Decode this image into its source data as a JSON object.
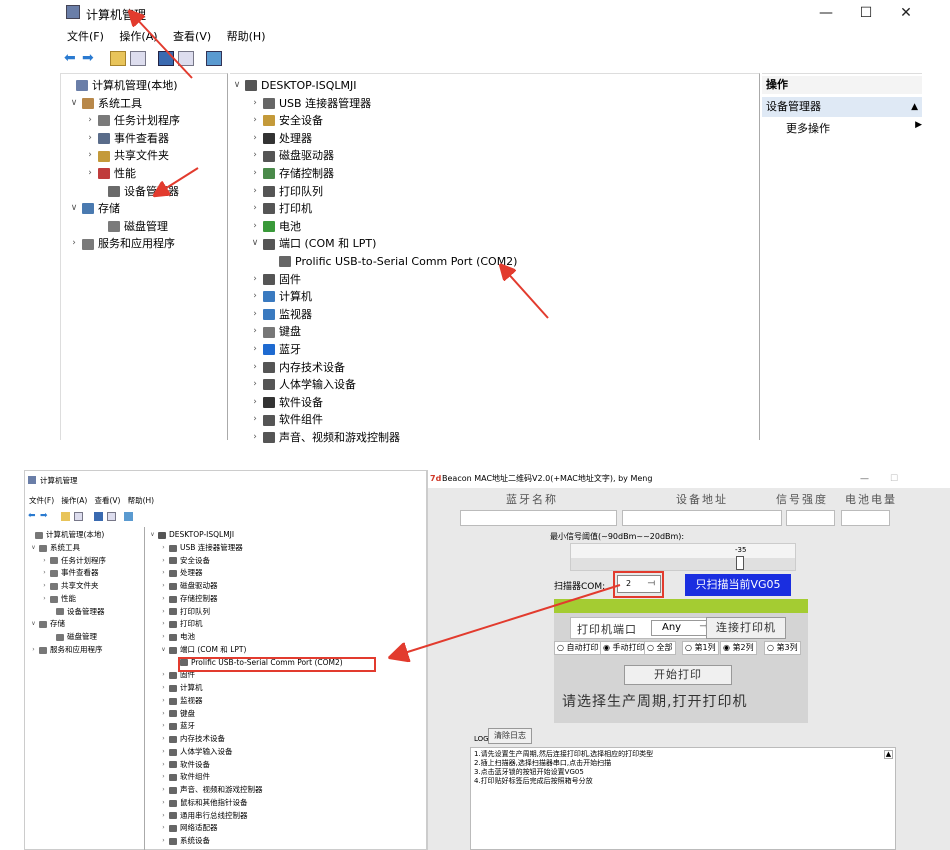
{
  "top_window": {
    "title": "计算机管理",
    "controls": {
      "minimize": "—",
      "maximize": "☐",
      "close": "✕"
    },
    "menu": [
      "文件(F)",
      "操作(A)",
      "查看(V)",
      "帮助(H)"
    ],
    "left_tree": [
      {
        "label": "计算机管理(本地)",
        "chev": "",
        "icon_color": "#6a7ea8"
      },
      {
        "label": "系统工具",
        "chev": "∨",
        "icon_color": "#b8884a"
      },
      {
        "label": "任务计划程序",
        "chev": "›",
        "icon_color": "#7a7a7a"
      },
      {
        "label": "事件查看器",
        "chev": "›",
        "icon_color": "#5a6c8a"
      },
      {
        "label": "共享文件夹",
        "chev": "›",
        "icon_color": "#c49a3a"
      },
      {
        "label": "性能",
        "chev": "›",
        "icon_color": "#c03c3c"
      },
      {
        "label": "设备管理器",
        "chev": "",
        "icon_color": "#6a6a6a"
      },
      {
        "label": "存储",
        "chev": "∨",
        "icon_color": "#4a7ab0"
      },
      {
        "label": "磁盘管理",
        "chev": "",
        "icon_color": "#7a7a7a"
      },
      {
        "label": "服务和应用程序",
        "chev": "›",
        "icon_color": "#7a7a7a"
      }
    ],
    "device_tree": {
      "root": "DESKTOP-ISQLMJI",
      "items": [
        {
          "label": "USB 连接器管理器",
          "chev": "›",
          "icon_color": "#666"
        },
        {
          "label": "安全设备",
          "chev": "›",
          "icon_color": "#c49a3a"
        },
        {
          "label": "处理器",
          "chev": "›",
          "icon_color": "#333"
        },
        {
          "label": "磁盘驱动器",
          "chev": "›",
          "icon_color": "#555"
        },
        {
          "label": "存储控制器",
          "chev": "›",
          "icon_color": "#4a8a4a"
        },
        {
          "label": "打印队列",
          "chev": "›",
          "icon_color": "#555"
        },
        {
          "label": "打印机",
          "chev": "›",
          "icon_color": "#555"
        },
        {
          "label": "电池",
          "chev": "›",
          "icon_color": "#3a9a3a"
        },
        {
          "label": "端口 (COM 和 LPT)",
          "chev": "∨",
          "icon_color": "#555"
        },
        {
          "label": "Prolific USB-to-Serial Comm Port (COM2)",
          "chev": "",
          "icon_color": "#666",
          "child": true
        },
        {
          "label": "固件",
          "chev": "›",
          "icon_color": "#555"
        },
        {
          "label": "计算机",
          "chev": "›",
          "icon_color": "#3a7ac0"
        },
        {
          "label": "监视器",
          "chev": "›",
          "icon_color": "#3a7ac0"
        },
        {
          "label": "键盘",
          "chev": "›",
          "icon_color": "#777"
        },
        {
          "label": "蓝牙",
          "chev": "›",
          "icon_color": "#1e6ad0"
        },
        {
          "label": "内存技术设备",
          "chev": "›",
          "icon_color": "#555"
        },
        {
          "label": "人体学输入设备",
          "chev": "›",
          "icon_color": "#555"
        },
        {
          "label": "软件设备",
          "chev": "›",
          "icon_color": "#333"
        },
        {
          "label": "软件组件",
          "chev": "›",
          "icon_color": "#555"
        },
        {
          "label": "声音、视频和游戏控制器",
          "chev": "›",
          "icon_color": "#555"
        }
      ]
    },
    "actions": {
      "header": "操作",
      "section": "设备管理器",
      "more": "更多操作",
      "section_arrow": "▲",
      "more_arrow": "▶"
    }
  },
  "bottom_left_window": {
    "title": "计算机管理",
    "menu": [
      "文件(F)",
      "操作(A)",
      "查看(V)",
      "帮助(H)"
    ],
    "left_tree": [
      {
        "label": "计算机管理(本地)",
        "chev": ""
      },
      {
        "label": "系统工具",
        "chev": "∨"
      },
      {
        "label": "任务计划程序",
        "chev": "›"
      },
      {
        "label": "事件查看器",
        "chev": "›"
      },
      {
        "label": "共享文件夹",
        "chev": "›"
      },
      {
        "label": "性能",
        "chev": "›"
      },
      {
        "label": "设备管理器",
        "chev": ""
      },
      {
        "label": "存储",
        "chev": "∨"
      },
      {
        "label": "磁盘管理",
        "chev": ""
      },
      {
        "label": "服务和应用程序",
        "chev": "›"
      }
    ],
    "device_tree": {
      "root": "DESKTOP-ISQLMJI",
      "items": [
        {
          "label": "USB 连接器管理器",
          "chev": "›"
        },
        {
          "label": "安全设备",
          "chev": "›"
        },
        {
          "label": "处理器",
          "chev": "›"
        },
        {
          "label": "磁盘驱动器",
          "chev": "›"
        },
        {
          "label": "存储控制器",
          "chev": "›"
        },
        {
          "label": "打印队列",
          "chev": "›"
        },
        {
          "label": "打印机",
          "chev": "›"
        },
        {
          "label": "电池",
          "chev": "›"
        },
        {
          "label": "端口 (COM 和 LPT)",
          "chev": "∨"
        },
        {
          "label": "Prolific USB-to-Serial Comm Port (COM2)",
          "chev": "",
          "child": true
        },
        {
          "label": "固件",
          "chev": "›"
        },
        {
          "label": "计算机",
          "chev": "›"
        },
        {
          "label": "监视器",
          "chev": "›"
        },
        {
          "label": "键盘",
          "chev": "›"
        },
        {
          "label": "蓝牙",
          "chev": "›"
        },
        {
          "label": "内存技术设备",
          "chev": "›"
        },
        {
          "label": "人体学输入设备",
          "chev": "›"
        },
        {
          "label": "软件设备",
          "chev": "›"
        },
        {
          "label": "软件组件",
          "chev": "›"
        },
        {
          "label": "声音、视频和游戏控制器",
          "chev": "›"
        },
        {
          "label": "鼠标和其他指针设备",
          "chev": "›"
        },
        {
          "label": "通用串行总线控制器",
          "chev": "›"
        },
        {
          "label": "网络适配器",
          "chev": "›"
        },
        {
          "label": "系统设备",
          "chev": "›"
        }
      ]
    }
  },
  "beacon_app": {
    "title": "Beacon MAC地址二维码V2.0(+MAC地址文字), by Meng",
    "title_icon": "7d",
    "controls": {
      "minimize": "—",
      "close": "☐"
    },
    "columns": [
      "蓝牙名称",
      "设备地址",
      "信号强度",
      "电池电量"
    ],
    "min_signal_label": "最小信号阈值(~90dBm~~20dBm):",
    "slider_value": "-35",
    "slider_fraction": 0.73,
    "scanner_label": "扫描器COM:",
    "com_value": "2",
    "scan_current_button": "只扫描当前VG05",
    "printer_port_label": "打印机端口",
    "printer_port_value": "Any",
    "connect_printer_button": "连接打印机",
    "radios": [
      {
        "label": "自动打印",
        "checked": false
      },
      {
        "label": "手动打印",
        "checked": true
      },
      {
        "label": "全部",
        "checked": false
      },
      {
        "label": "第1列",
        "checked": false
      },
      {
        "label": "第2列",
        "checked": true
      },
      {
        "label": "第3列",
        "checked": false
      }
    ],
    "start_print_button": "开始打印",
    "status_message": "请选择生产周期,打开打印机",
    "log_label": "LOG",
    "clear_log_button": "清除日志",
    "log_lines": [
      "1.请先设置生产周期,然后连接打印机,选择相应的打印类型",
      "2.插上扫描器,选择扫描器串口,点击开始扫描",
      "3.点击蓝牙锁的按钮开始设置VG05",
      "4.打印贴好标签后完成后按照箱号分放"
    ],
    "accent_green": "#a4cc32",
    "accent_blue": "#1a2ee0"
  }
}
